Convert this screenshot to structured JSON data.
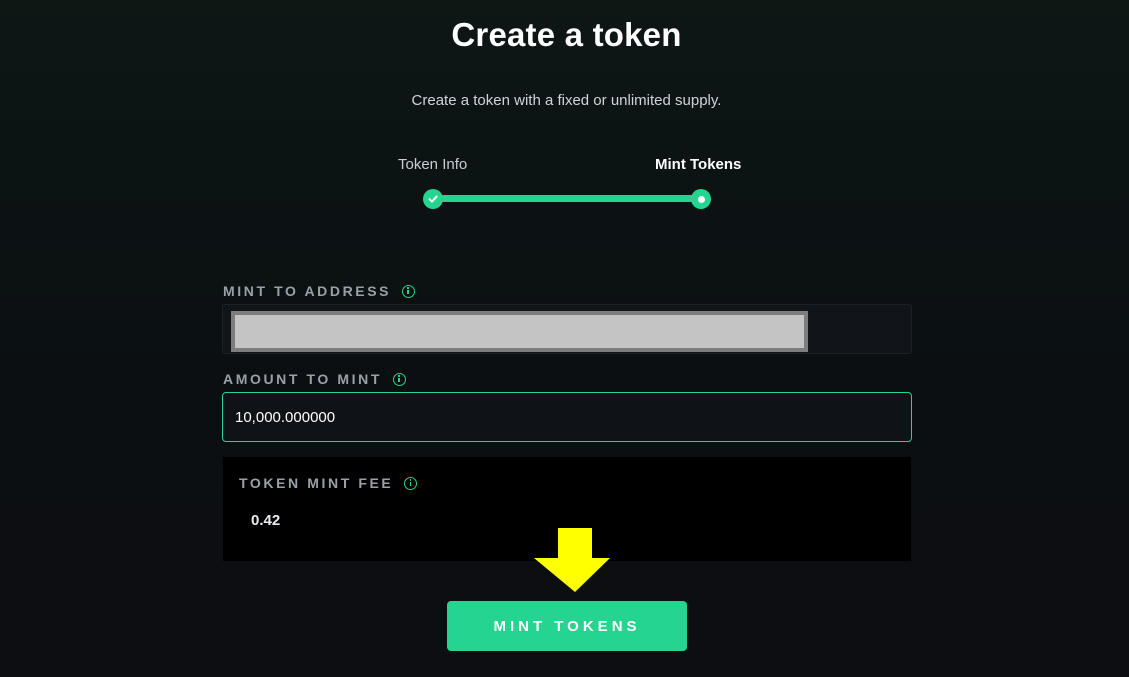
{
  "header": {
    "title": "Create a token",
    "subtitle": "Create a token with a fixed or unlimited supply."
  },
  "stepper": {
    "steps": [
      {
        "label": "Token Info",
        "state": "completed",
        "icon": "check-icon"
      },
      {
        "label": "Mint Tokens",
        "state": "current",
        "icon": "current-step-dot-icon"
      }
    ],
    "progress_percent": 100,
    "accent_color": "#25d58f"
  },
  "form": {
    "mint_to_address": {
      "label": "MINT TO ADDRESS",
      "info_icon": "info-icon",
      "value_state": "redacted"
    },
    "amount_to_mint": {
      "label": "AMOUNT TO MINT",
      "info_icon": "info-icon",
      "value": "10,000.000000"
    },
    "token_mint_fee": {
      "label": "TOKEN MINT FEE",
      "info_icon": "info-icon",
      "value": "0.42"
    }
  },
  "annotation": {
    "icon": "arrow-down-icon",
    "color": "#ffff00"
  },
  "actions": {
    "mint_label": "MINT TOKENS"
  },
  "colors": {
    "background": "#0b0f12",
    "button": "#25d58f",
    "label": "#9aa0a7"
  }
}
